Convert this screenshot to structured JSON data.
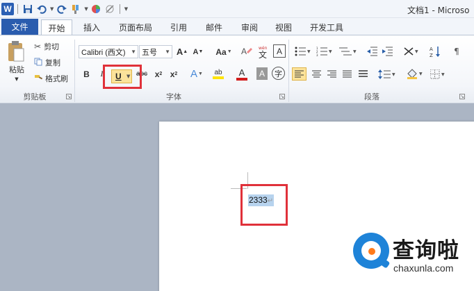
{
  "app": {
    "window_title": "文档1 - Microso"
  },
  "quick_access": {
    "logo_letter": "W",
    "save_icon": "save-icon",
    "undo_icon": "undo-icon",
    "redo_icon": "redo-icon"
  },
  "tabs": {
    "file": "文件",
    "items": [
      "开始",
      "插入",
      "页面布局",
      "引用",
      "邮件",
      "审阅",
      "视图",
      "开发工具"
    ],
    "active": "开始"
  },
  "clipboard": {
    "paste": "粘贴",
    "cut": "剪切",
    "copy": "复制",
    "format_painter": "格式刷",
    "group_label": "剪贴板"
  },
  "font": {
    "font_name": "Calibri (西文)",
    "font_size": "五号",
    "grow": "A",
    "shrink": "A",
    "change_case": "Aa",
    "bold": "B",
    "italic": "I",
    "underline": "U",
    "strikethrough": "abc",
    "subscript": "x",
    "superscript": "x",
    "text_effects": "A",
    "highlight": "ab",
    "font_color": "A",
    "char_shading": "A",
    "enclose": "字",
    "group_label": "字体"
  },
  "paragraph": {
    "group_label": "段落"
  },
  "document": {
    "text": "2333",
    "para_mark": "↵"
  },
  "watermark": {
    "cn": "查询啦",
    "url": "chaxunla.com"
  },
  "colors": {
    "file_tab": "#2a5cae",
    "highlight_red": "#e0313a",
    "selection": "#b7d3ee",
    "underline_active": "#fbe39b"
  }
}
